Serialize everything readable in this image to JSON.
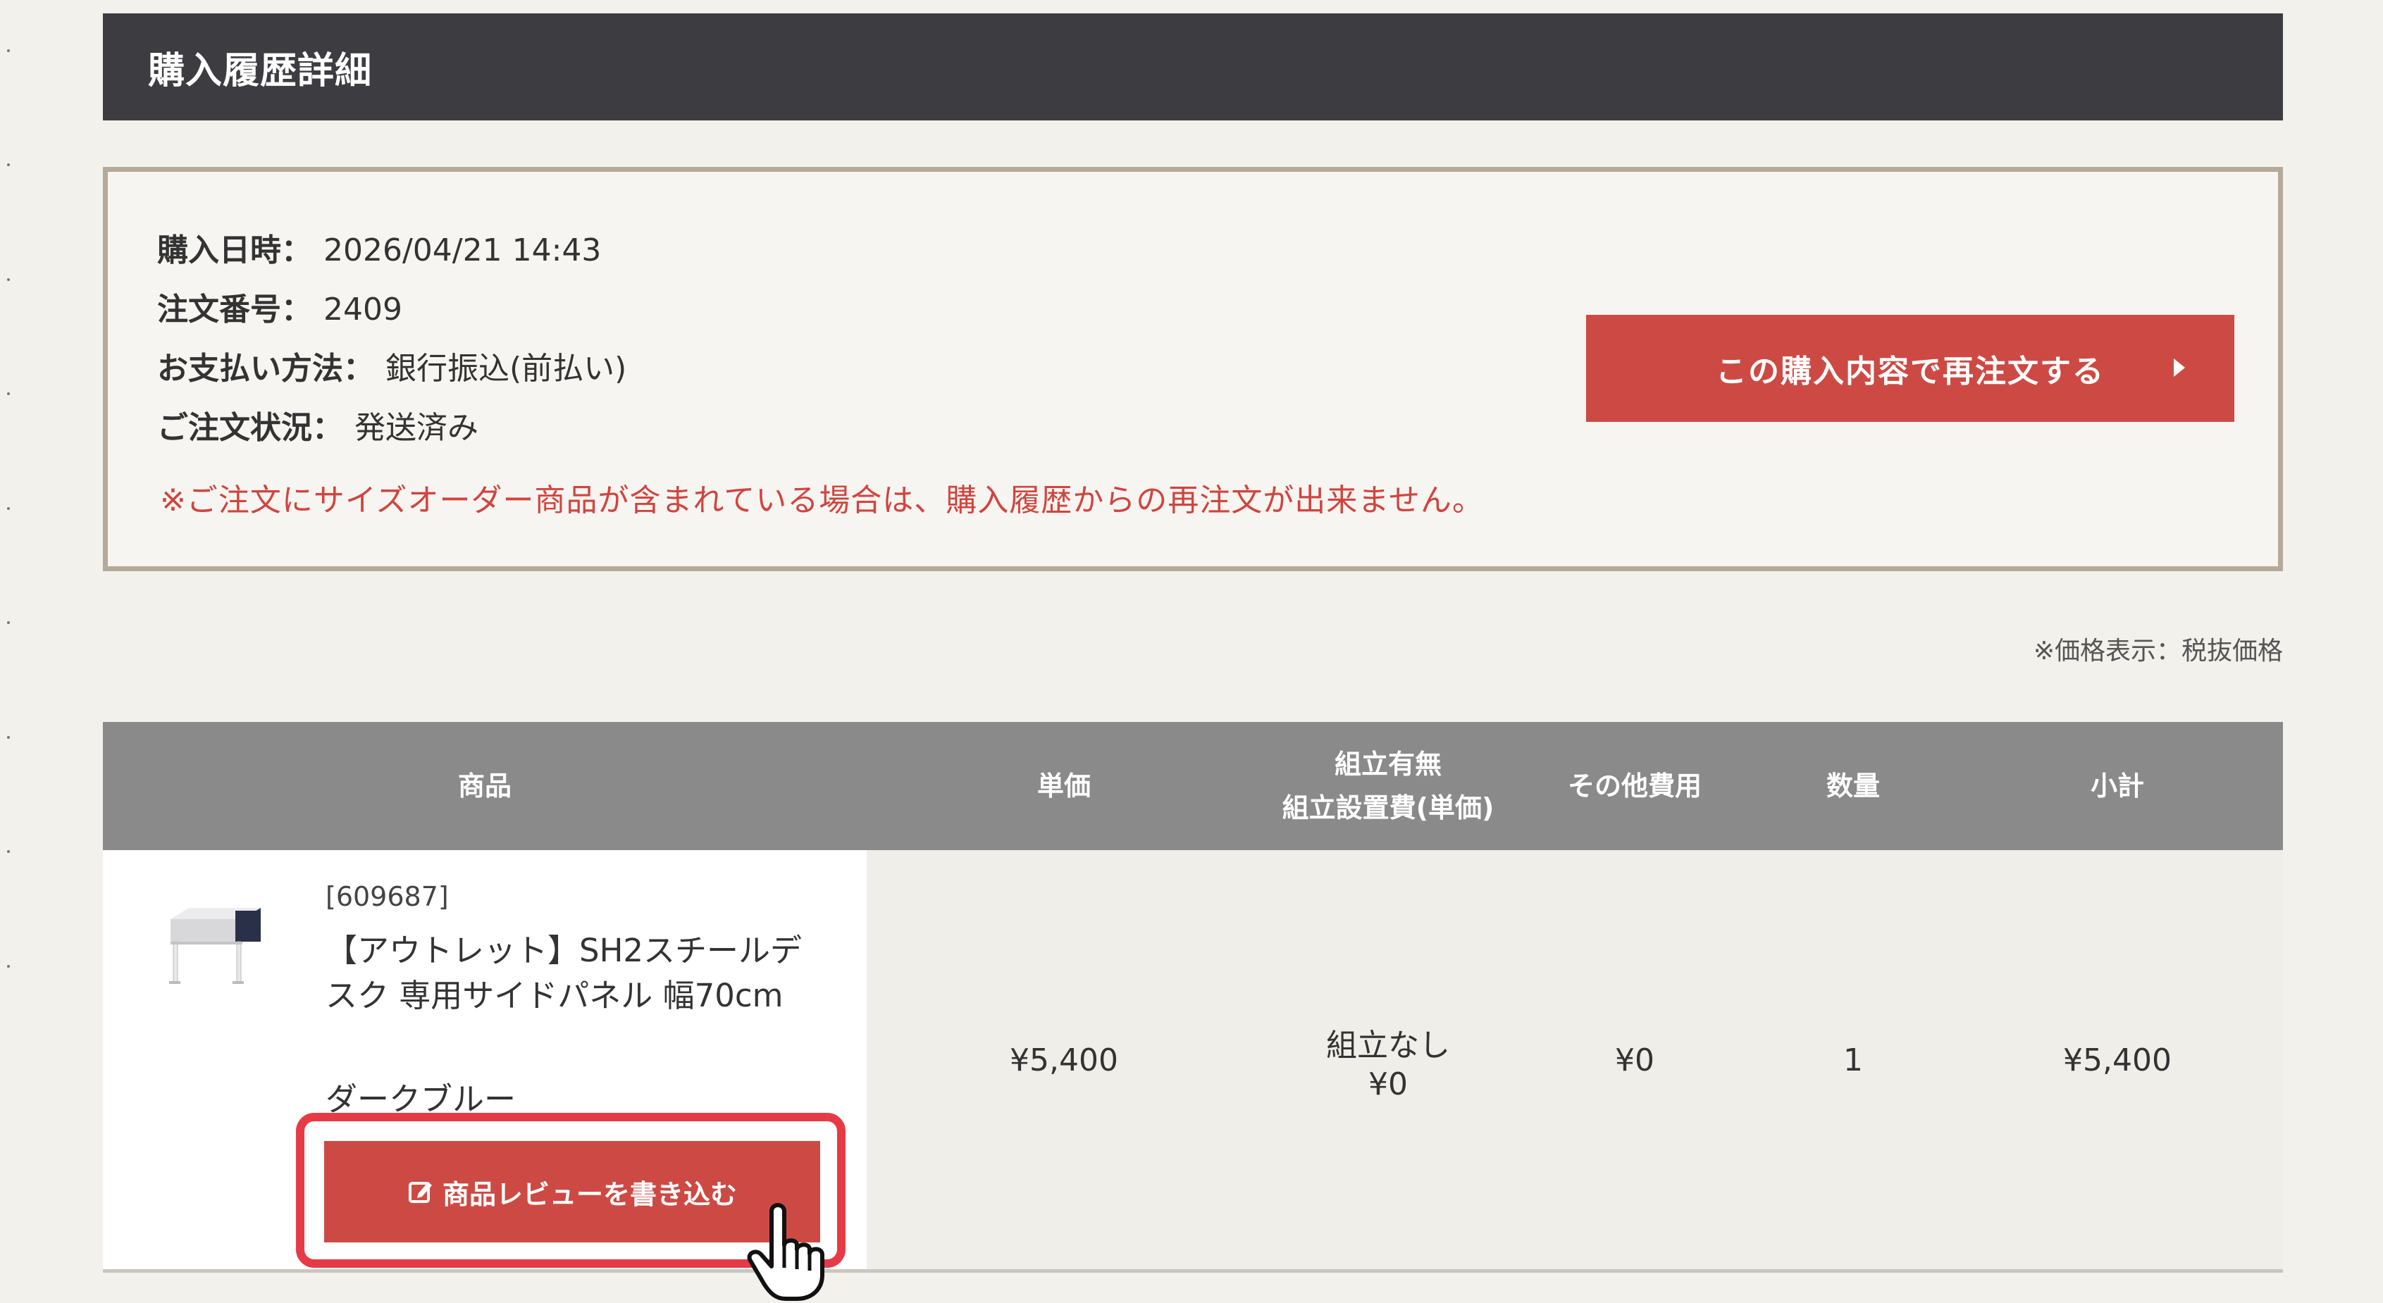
{
  "header": {
    "title": "購入履歴詳細"
  },
  "order_info": {
    "date_label": "購入日時：",
    "date_value": "2026/04/21 14:43",
    "number_label": "注文番号：",
    "number_value": "2409",
    "payment_label": "お支払い方法：",
    "payment_value": "銀行振込(前払い)",
    "status_label": "ご注文状況：",
    "status_value": "発送済み",
    "notice": "※ご注文にサイズオーダー商品が含まれている場合は、購入履歴からの再注文が出来ません。",
    "reorder_button": "この購入内容で再注文する"
  },
  "price_note": "※価格表示：税抜価格",
  "table": {
    "headers": {
      "product": "商品",
      "unit_price": "単価",
      "assembly_line1": "組立有無",
      "assembly_line2": "組立設置費(単価)",
      "other_fees": "その他費用",
      "quantity": "数量",
      "subtotal": "小計"
    },
    "row": {
      "sku": "[609687]",
      "name": "【アウトレット】SH2スチールデスク 専用サイドパネル 幅70cm",
      "color": "ダークブルー",
      "unit_price": "¥5,400",
      "assembly": "組立なし",
      "assembly_fee": "¥0",
      "other_fees": "¥0",
      "quantity": "1",
      "subtotal": "¥5,400",
      "review_button": "商品レビューを書き込む"
    }
  },
  "colors": {
    "header_bg": "#3c3c41",
    "accent_red": "#cd4a44",
    "highlight_red": "#e63b46",
    "table_head_bg": "#8a8a8a"
  }
}
